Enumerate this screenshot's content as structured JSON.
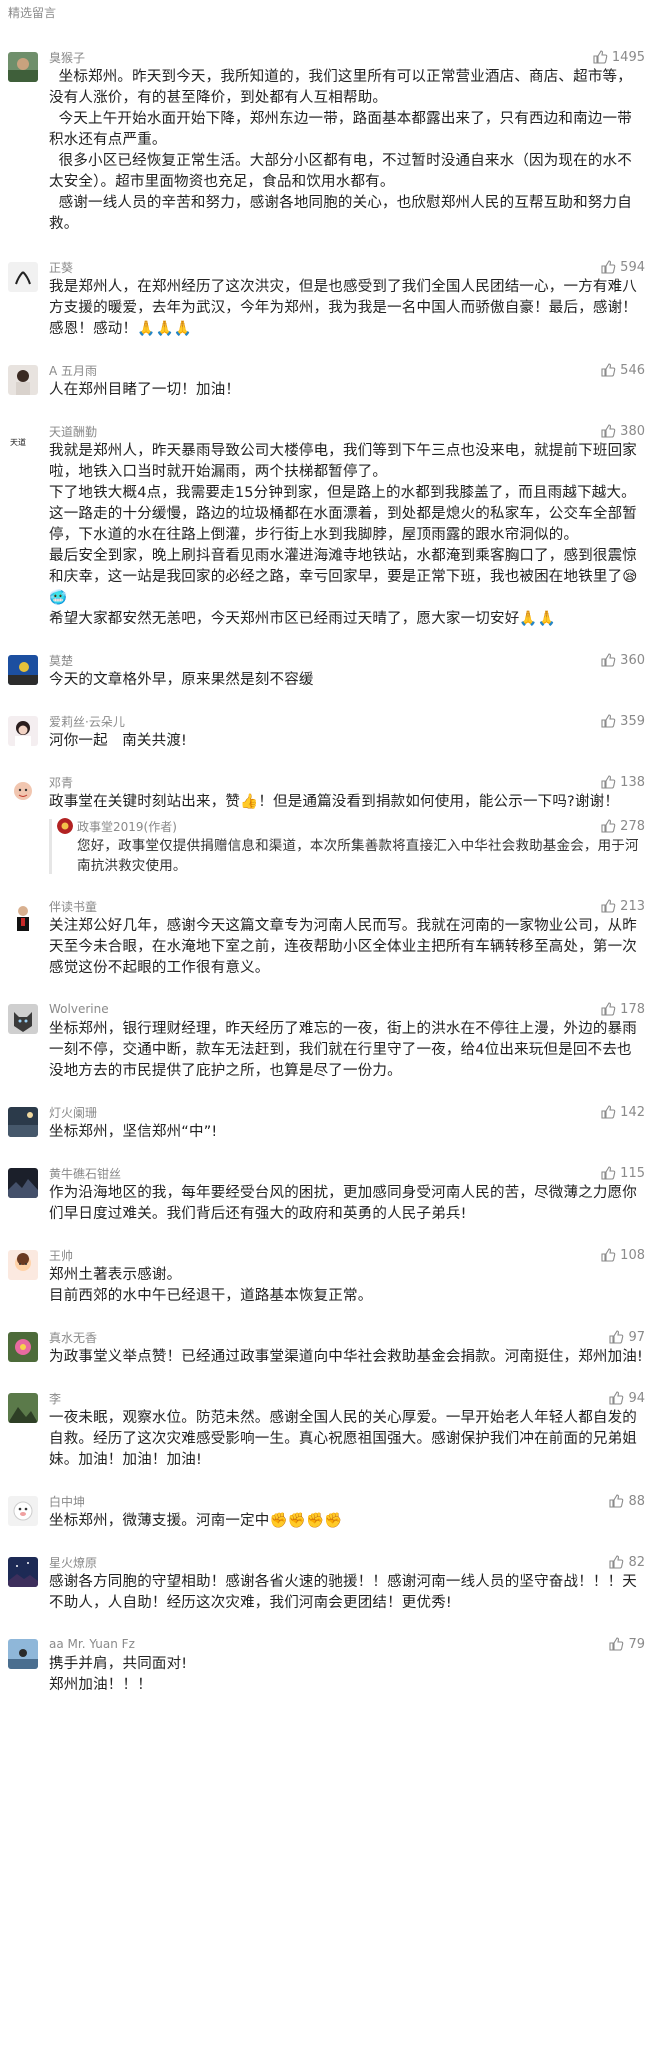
{
  "header": {
    "title": "精选留言"
  },
  "comments": [
    {
      "nickname": "臭猴子",
      "likes": "1495",
      "text": "  坐标郑州。昨天到今天，我所知道的，我们这里所有可以正常营业酒店、商店、超市等，没有人涨价，有的甚至降价，到处都有人互相帮助。\n  今天上午开始水面开始下降，郑州东边一带，路面基本都露出来了，只有西边和南边一带积水还有点严重。\n  很多小区已经恢复正常生活。大部分小区都有电，不过暂时没通自来水（因为现在的水不太安全）。超市里面物资也充足，食品和饮用水都有。\n  感谢一线人员的辛苦和努力，感谢各地同胞的关心，也欣慰郑州人民的互帮互助和努力自救。"
    },
    {
      "nickname": "正葵",
      "likes": "594",
      "text": "我是郑州人，在郑州经历了这次洪灾，但是也感受到了我们全国人民团结一心，一方有难八方支援的暖爱，去年为武汉，今年为郑州，我为我是一名中国人而骄傲自豪！最后，感谢！感恩！感动！🙏🙏🙏"
    },
    {
      "nickname": "A 五月雨",
      "likes": "546",
      "text": "人在郑州目睹了一切！加油！"
    },
    {
      "nickname": "天道酬勤",
      "likes": "380",
      "text": "我就是郑州人，昨天暴雨导致公司大楼停电，我们等到下午三点也没来电，就提前下班回家啦，地铁入口当时就开始漏雨，两个扶梯都暂停了。\n下了地铁大概4点，我需要走15分钟到家，但是路上的水都到我膝盖了，而且雨越下越大。\n这一路走的十分缓慢，路边的垃圾桶都在水面漂着，到处都是熄火的私家车，公交车全部暂停，下水道的水在往路上倒灌，步行街上水到我脚脖，屋顶雨露的跟水帘洞似的。\n最后安全到家，晚上刷抖音看见雨水灌进海滩寺地铁站，水都淹到乘客胸口了，感到很震惊和庆幸，这一站是我回家的必经之路，幸亏回家早，要是正常下班，我也被困在地铁里了😪🥶\n希望大家都安然无恙吧，今天郑州市区已经雨过天晴了，愿大家一切安好🙏🙏"
    },
    {
      "nickname": "莫楚",
      "likes": "360",
      "text": "今天的文章格外早，原来果然是刻不容缓"
    },
    {
      "nickname": "爱莉丝·云朵儿",
      "likes": "359",
      "text": "河你一起   南关共渡!"
    },
    {
      "nickname": "邓青",
      "likes": "138",
      "text": "政事堂在关键时刻站出来，赞👍！但是通篇没看到捐款如何使用，能公示一下吗?谢谢！",
      "reply": {
        "nickname": "政事堂2019(作者)",
        "likes": "278",
        "text": "您好，政事堂仅提供捐赠信息和渠道，本次所集善款将直接汇入中华社会救助基金会，用于河南抗洪救灾使用。"
      }
    },
    {
      "nickname": "伴读书童",
      "likes": "213",
      "text": "关注郑公好几年，感谢今天这篇文章专为河南人民而写。我就在河南的一家物业公司，从昨天至今未合眼，在水淹地下室之前，连夜帮助小区全体业主把所有车辆转移至高处，第一次感觉这份不起眼的工作很有意义。"
    },
    {
      "nickname": "Wolverine",
      "likes": "178",
      "text": "坐标郑州，银行理财经理，昨天经历了难忘的一夜，街上的洪水在不停往上漫，外边的暴雨一刻不停，交通中断，款车无法赶到，我们就在行里守了一夜，给4位出来玩但是回不去也没地方去的市民提供了庇护之所，也算是尽了一份力。"
    },
    {
      "nickname": "灯火阑珊",
      "likes": "142",
      "text": "坐标郑州，坚信郑州“中”!"
    },
    {
      "nickname": "黄牛礁石钳丝",
      "likes": "115",
      "text": "作为沿海地区的我，每年要经受台风的困扰，更加感同身受河南人民的苦，尽微薄之力愿你们早日度过难关。我们背后还有强大的政府和英勇的人民子弟兵!"
    },
    {
      "nickname": "王帅",
      "likes": "108",
      "text": "郑州土著表示感谢。\n目前西郊的水中午已经退干，道路基本恢复正常。"
    },
    {
      "nickname": "真水无香",
      "likes": "97",
      "text": "为政事堂义举点赞！已经通过政事堂渠道向中华社会救助基金会捐款。河南挺住，郑州加油!"
    },
    {
      "nickname": "李",
      "likes": "94",
      "text": "一夜未眠，观察水位。防范未然。感谢全国人民的关心厚爱。一早开始老人年轻人都自发的自救。经历了这次灾难感受影响一生。真心祝愿祖国强大。感谢保护我们冲在前面的兄弟姐妹。加油！加油！加油!"
    },
    {
      "nickname": "白中坤",
      "likes": "88",
      "text": "坐标郑州，微薄支援。河南一定中✊✊✊✊"
    },
    {
      "nickname": "星火燎原",
      "likes": "82",
      "text": "感谢各方同胞的守望相助！感谢各省火速的驰援！！感谢河南一线人员的坚守奋战！！！天不助人，人自助！经历这次灾难，我们河南会更团结！更优秀!"
    },
    {
      "nickname": "aa Mr. Yuan Fz",
      "likes": "79",
      "text": "携手并肩，共同面对!\n郑州加油！！！"
    }
  ],
  "colors": {
    "nickname": "#8a8a8a",
    "body": "#222222",
    "header": "#8c8c8c",
    "background": "#ffffff"
  },
  "icons": {
    "like": "thumbs-up-icon"
  }
}
